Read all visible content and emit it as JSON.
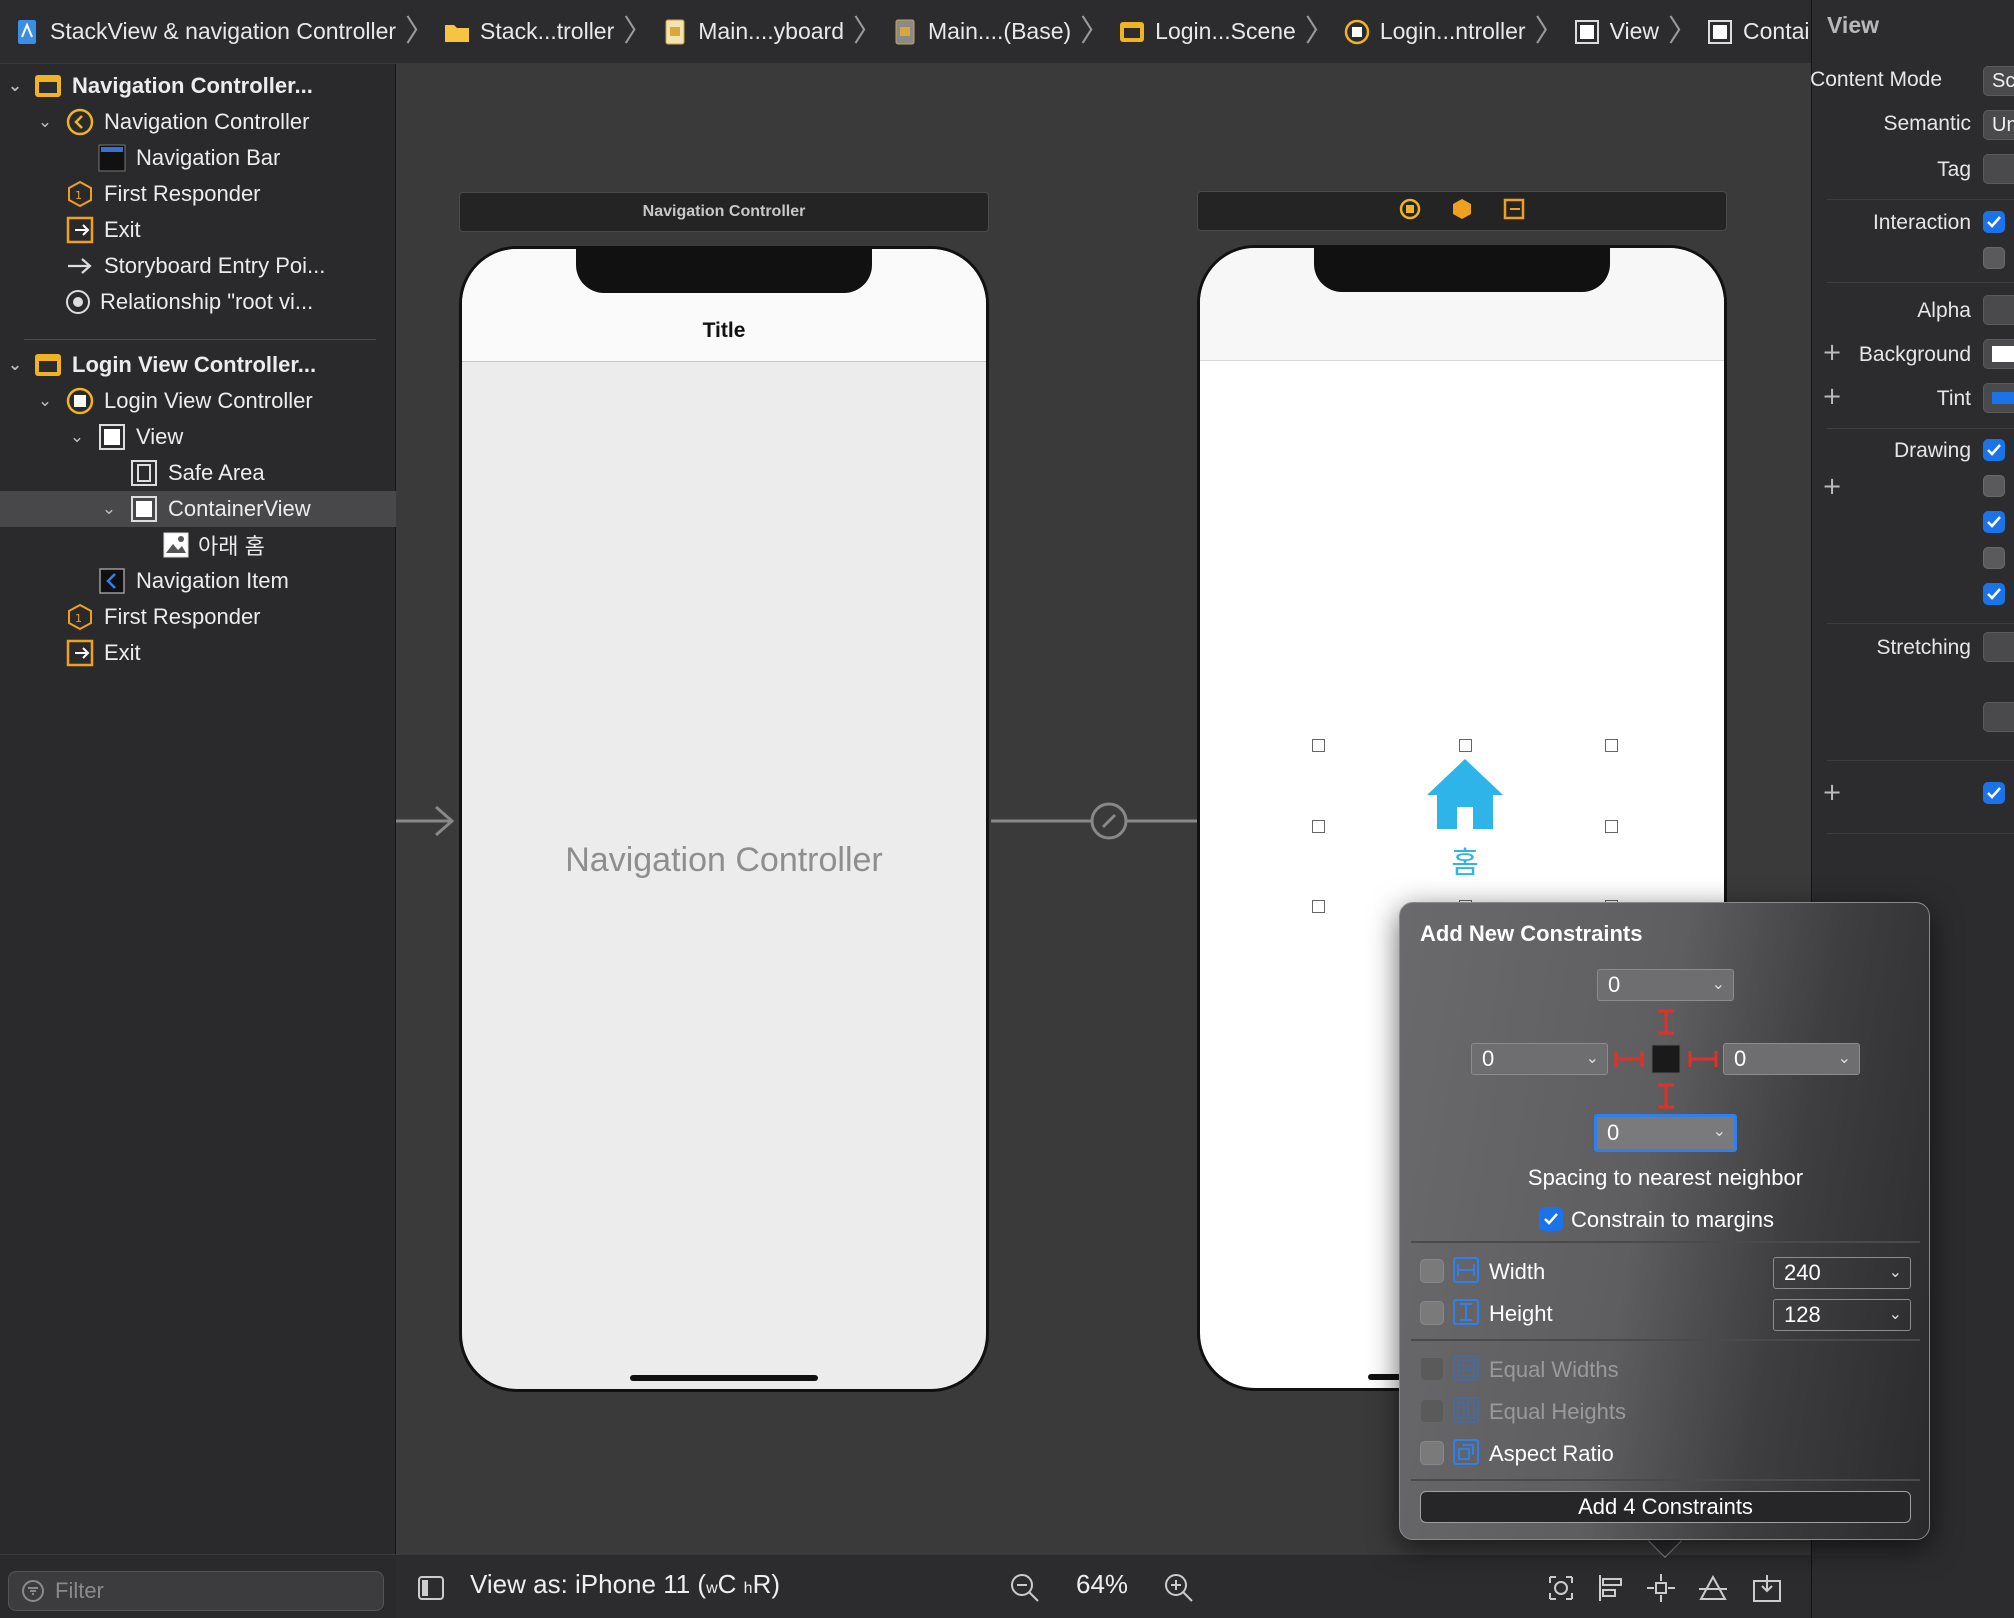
{
  "breadcrumb": {
    "items": [
      {
        "label": "StackView & navigation Controller",
        "icon": "project-icon"
      },
      {
        "label": "Stack...troller",
        "icon": "folder-icon"
      },
      {
        "label": "Main....yboard",
        "icon": "storyboard-icon"
      },
      {
        "label": "Main....(Base)",
        "icon": "storyboard-base-icon"
      },
      {
        "label": "Login...Scene",
        "icon": "scene-icon"
      },
      {
        "label": "Login...ntroller",
        "icon": "view-controller-icon"
      },
      {
        "label": "View",
        "icon": "view-icon"
      },
      {
        "label": "ContainerView",
        "icon": "view-icon"
      }
    ]
  },
  "outline": {
    "items": [
      {
        "label": "Navigation Controller...",
        "icon": "scene-icon",
        "bold": true,
        "expanded": true
      },
      {
        "label": "Navigation Controller",
        "icon": "navigation-controller-icon",
        "expanded": true
      },
      {
        "label": "Navigation Bar",
        "icon": "navigation-bar-icon"
      },
      {
        "label": "First Responder",
        "icon": "first-responder-icon"
      },
      {
        "label": "Exit",
        "icon": "exit-icon"
      },
      {
        "label": "Storyboard Entry Poi...",
        "icon": "entry-arrow-icon"
      },
      {
        "label": "Relationship \"root vi...",
        "icon": "relationship-icon"
      },
      {
        "label": "Login View Controller...",
        "icon": "scene-icon",
        "bold": true,
        "expanded": true
      },
      {
        "label": "Login View Controller",
        "icon": "view-controller-icon",
        "expanded": true
      },
      {
        "label": "View",
        "icon": "view-icon",
        "expanded": true
      },
      {
        "label": "Safe Area",
        "icon": "safe-area-icon"
      },
      {
        "label": "ContainerView",
        "icon": "view-icon",
        "expanded": true,
        "selected": true
      },
      {
        "label": "아래 홈",
        "icon": "image-view-icon"
      },
      {
        "label": "Navigation Item",
        "icon": "navigation-item-icon"
      },
      {
        "label": "First Responder",
        "icon": "first-responder-icon"
      },
      {
        "label": "Exit",
        "icon": "exit-icon"
      }
    ],
    "filter_placeholder": "Filter"
  },
  "canvas": {
    "nav_scene_header": "Navigation Controller",
    "nav_bar_title": "Title",
    "nav_placeholder": "Navigation Controller",
    "home_label": "홈",
    "accent_color": "#2fb4ea"
  },
  "bottom_bar": {
    "view_as": "View as: iPhone 11",
    "size_class_w": "w",
    "size_class_w_value": "C",
    "size_class_h": "h",
    "size_class_h_value": "R",
    "zoom": "64%"
  },
  "inspector": {
    "title": "View",
    "content_mode_label": "Content Mode",
    "content_mode_value": "Sc",
    "semantic_label": "Semantic",
    "semantic_value": "Un",
    "tag_label": "Tag",
    "interaction_label": "Interaction",
    "alpha_label": "Alpha",
    "background_label": "Background",
    "tint_label": "Tint",
    "drawing_label": "Drawing",
    "stretching_label": "Stretching",
    "tint_color": "#1a73e8"
  },
  "popover": {
    "title": "Add New Constraints",
    "top_value": "0",
    "leading_value": "0",
    "trailing_value": "0",
    "bottom_value": "0",
    "spacing_label": "Spacing to nearest neighbor",
    "constrain_margins_label": "Constrain to margins",
    "width_label": "Width",
    "width_value": "240",
    "height_label": "Height",
    "height_value": "128",
    "equal_widths_label": "Equal Widths",
    "equal_heights_label": "Equal Heights",
    "aspect_ratio_label": "Aspect Ratio",
    "add_button_label": "Add 4 Constraints",
    "strut_color": "#e0302a"
  }
}
